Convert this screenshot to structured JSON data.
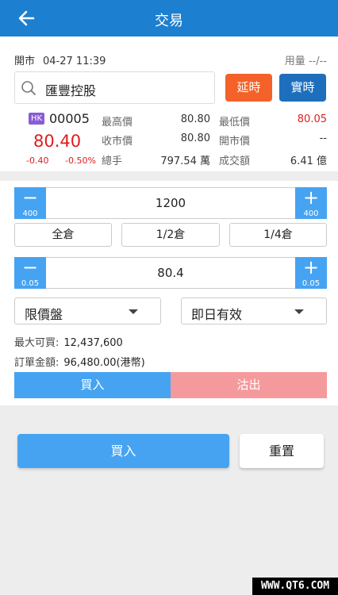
{
  "header": {
    "title": "交易",
    "back_icon": "arrow-left-icon"
  },
  "status": {
    "market": "開市",
    "time": "04-27 11:39",
    "usage": "用量 --/--"
  },
  "search": {
    "stock_name": "匯豐控股",
    "icon": "search-icon"
  },
  "mode_buttons": {
    "delay": "延時",
    "realtime": "實時"
  },
  "stock": {
    "exchange": "HK",
    "code": "00005",
    "price": "80.40",
    "change": "-0.40",
    "change_pct": "-0.50%"
  },
  "quote": {
    "high_label": "最高價",
    "high": "80.80",
    "low_label": "最低價",
    "low": "80.05",
    "close_label": "收市價",
    "close": "80.80",
    "open_label": "開市價",
    "open": "--",
    "volume_label": "總手",
    "volume": "797.54 萬",
    "turnover_label": "成交額",
    "turnover": "6.41 億"
  },
  "quantity": {
    "value": "1200",
    "step_down": "400",
    "step_up": "400"
  },
  "position_buttons": {
    "full": "全倉",
    "half": "1/2倉",
    "quarter": "1/4倉"
  },
  "price_input": {
    "value": "80.4",
    "step_down": "0.05",
    "step_up": "0.05"
  },
  "order_type": {
    "selected": "限價盤"
  },
  "validity": {
    "selected": "即日有效"
  },
  "info": {
    "max_buy_label": "最大可買:",
    "max_buy": "12,437,600",
    "amount_label": "訂單金額:",
    "amount": "96,480.00(港幣)"
  },
  "side": {
    "buy": "買入",
    "sell": "沽出"
  },
  "actions": {
    "submit": "買入",
    "reset": "重置"
  },
  "watermark": "WWW.QT6.COM",
  "colors": {
    "header": "#1d7fcf",
    "accent": "#46a3f2",
    "down": "#e01c1c",
    "delay": "#f4622a",
    "realtime": "#1d6fbd",
    "sell": "#f59a9c",
    "badge": "#8a5bd6"
  }
}
